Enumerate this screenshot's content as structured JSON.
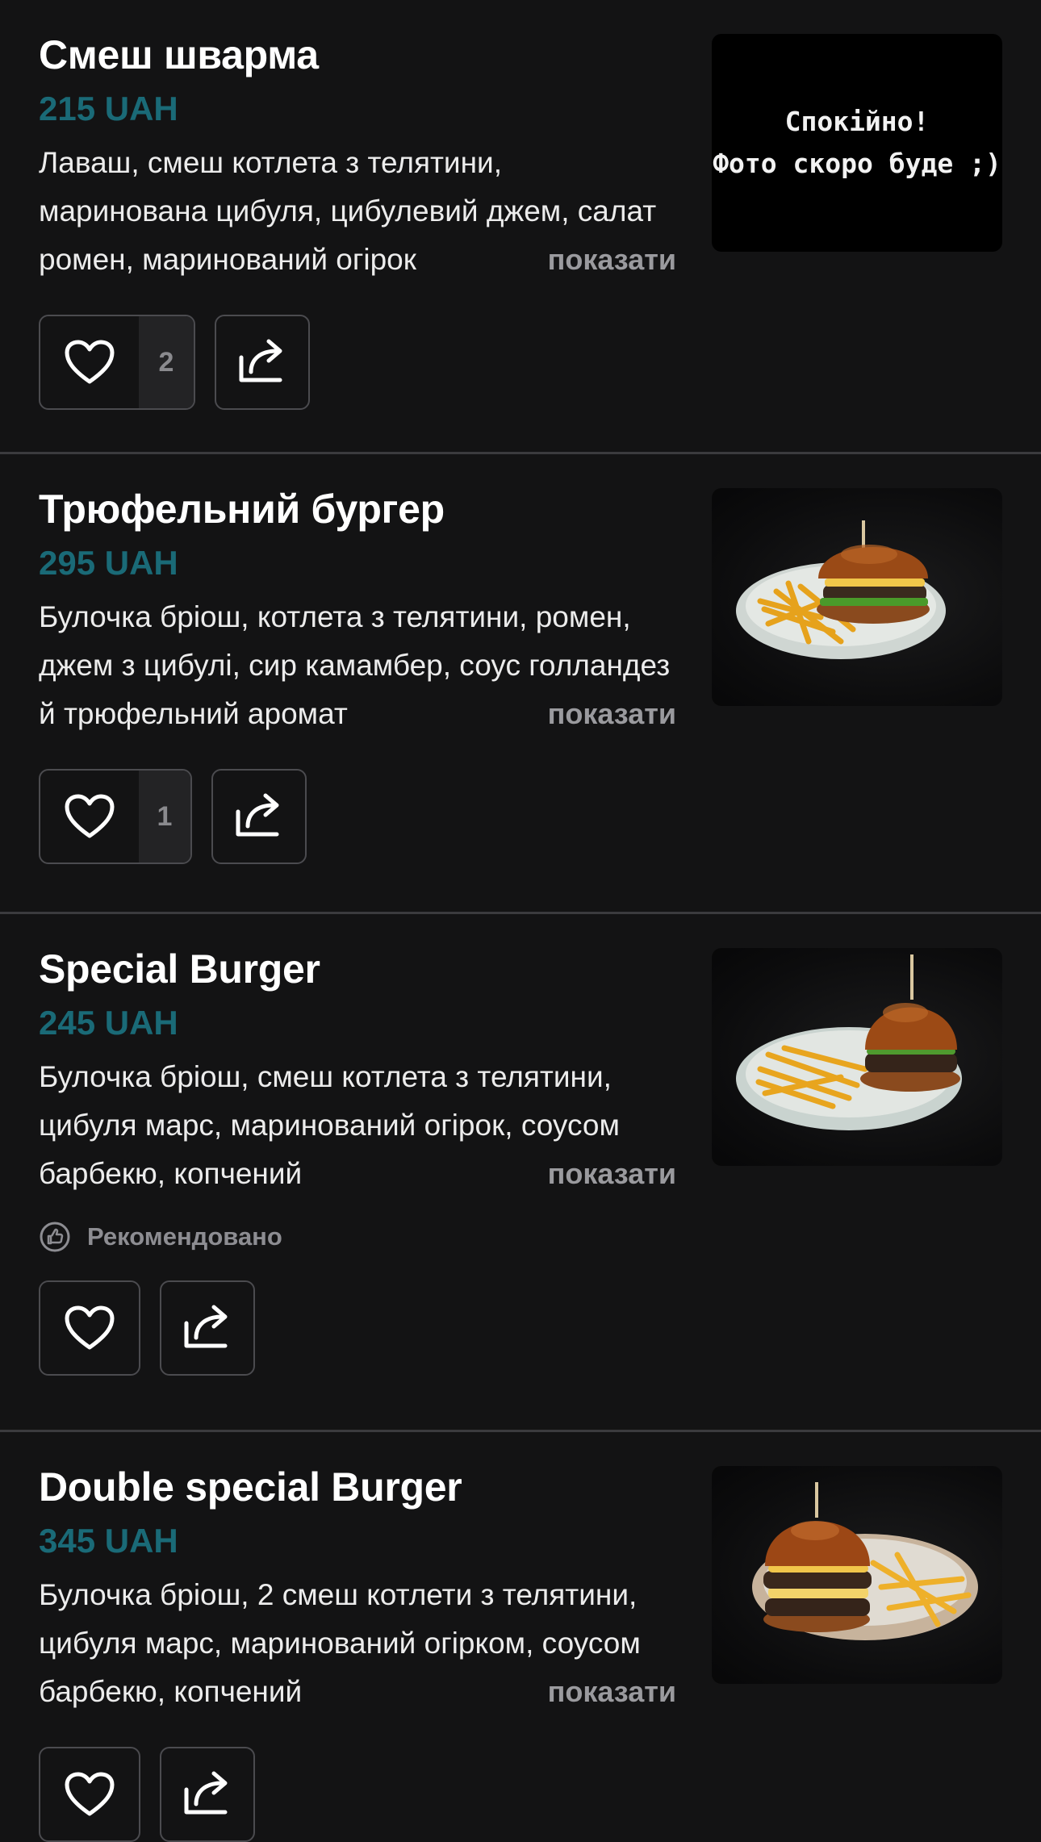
{
  "show_more_label": "показати",
  "recommended_label": "Рекомендовано",
  "items": [
    {
      "name": "Смеш шварма",
      "price": "215 UAH",
      "description": "Лаваш, смеш котлета з телятини, маринована цибуля, цибулевий джем, салат ромен, маринований огірок",
      "likes": "2",
      "photo_placeholder": {
        "line1": "Спокійно!",
        "line2": "Фото скоро буде ;)"
      }
    },
    {
      "name": "Трюфельний бургер",
      "price": "295 UAH",
      "description": "Булочка бріош, котлета з телятини, ромен, джем з цибулі, сир камамбер, соус голландез й трюфельний аромат",
      "likes": "1"
    },
    {
      "name": "Special Burger",
      "price": "245 UAH",
      "description": "Булочка бріош, смеш котлета з телятини, цибуля марс, маринований огірок, соусом барбекю, копчений"
    },
    {
      "name": "Double special Burger",
      "price": "345 UAH",
      "description": "Булочка бріош, 2 смеш котлети з телятини, цибуля марс, маринований огірком, соусом барбекю, копчений"
    }
  ],
  "colors": {
    "background": "#131314",
    "price": "#1a6a77",
    "divider": "#3b3b3e",
    "muted": "#8d8d92"
  },
  "icons": {
    "like": "heart-icon",
    "share": "share-icon",
    "recommended": "thumbs-up-icon"
  }
}
